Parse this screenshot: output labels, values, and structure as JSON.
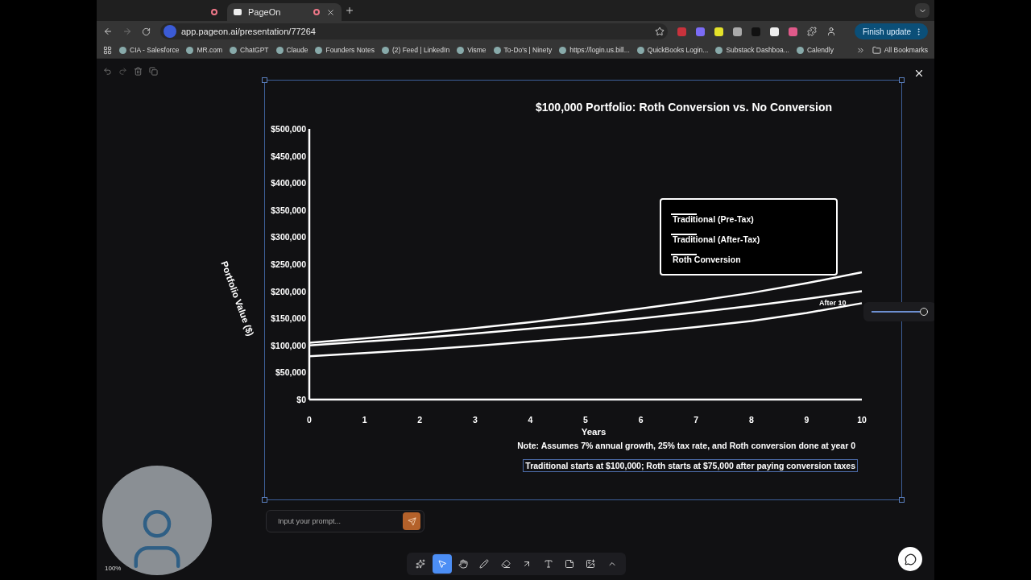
{
  "browser": {
    "tabs": [
      {
        "selected": false
      },
      {
        "label": "PageOn",
        "selected": true
      }
    ],
    "url": "app.pageon.ai/presentation/77264",
    "update_button": "Finish update",
    "bookmarks": [
      {
        "label": "CIA - Salesforce"
      },
      {
        "label": "MR.com"
      },
      {
        "label": "ChatGPT"
      },
      {
        "label": "Claude"
      },
      {
        "label": "Founders Notes"
      },
      {
        "label": "(2) Feed | LinkedIn"
      },
      {
        "label": "Visme"
      },
      {
        "label": "To-Do's | Ninety"
      },
      {
        "label": "https://login.us.bill..."
      },
      {
        "label": "QuickBooks Login..."
      },
      {
        "label": "Substack Dashboa..."
      },
      {
        "label": "Calendly"
      }
    ],
    "all_bookmarks": "All Bookmarks"
  },
  "slide": {
    "chart_data": {
      "type": "line",
      "title": "$100,000 Portfolio: Roth Conversion vs. No Conversion",
      "xlabel": "Years",
      "ylabel": "Portfolio Value ($)",
      "x": [
        0,
        1,
        2,
        3,
        4,
        5,
        6,
        7,
        8,
        9,
        10
      ],
      "xlim": [
        0,
        10
      ],
      "ylim": [
        0,
        500000
      ],
      "xticks": [
        0,
        1,
        2,
        3,
        4,
        5,
        6,
        7,
        8,
        9,
        10
      ],
      "yticks": [
        {
          "value": 0,
          "label": "$0"
        },
        {
          "value": 50000,
          "label": "$50,000"
        },
        {
          "value": 100000,
          "label": "$100,000"
        },
        {
          "value": 150000,
          "label": "$150,000"
        },
        {
          "value": 200000,
          "label": "$200,000"
        },
        {
          "value": 250000,
          "label": "$250,000"
        },
        {
          "value": 300000,
          "label": "$300,000"
        },
        {
          "value": 350000,
          "label": "$350,000"
        },
        {
          "value": 400000,
          "label": "$400,000"
        },
        {
          "value": 450000,
          "label": "$450,000"
        },
        {
          "value": 500000,
          "label": "$500,000"
        }
      ],
      "series": [
        {
          "name": "Traditional (Pre-Tax)",
          "color": "#ffffff",
          "values": [
            105000,
            113000,
            122000,
            132000,
            143000,
            155000,
            168000,
            182000,
            197000,
            215000,
            235000
          ]
        },
        {
          "name": "Traditional (After-Tax)",
          "color": "#ffffff",
          "values": [
            100000,
            107000,
            114000,
            122000,
            131000,
            140000,
            150000,
            161000,
            173000,
            186000,
            200000
          ]
        },
        {
          "name": "Roth Conversion",
          "color": "#ffffff",
          "values": [
            80000,
            86000,
            92000,
            99000,
            107000,
            115000,
            124000,
            134000,
            145000,
            160000,
            178000
          ]
        }
      ],
      "legend": true,
      "annotations": [
        "After 10"
      ]
    },
    "notes": [
      "Note: Assumes 7% annual growth, 25% tax rate, and Roth conversion done at year 0",
      "Traditional starts at $100,000; Roth starts at $75,000 after paying conversion taxes"
    ]
  },
  "slider": {
    "level": 1
  },
  "prompt": {
    "placeholder": "Input your prompt..."
  },
  "tools": [
    {
      "kind": "magic",
      "selected": false
    },
    {
      "kind": "select",
      "selected": true
    },
    {
      "kind": "hand",
      "selected": false
    },
    {
      "kind": "draw",
      "selected": false
    },
    {
      "kind": "eraser",
      "selected": false
    },
    {
      "kind": "arrow",
      "selected": false
    },
    {
      "kind": "text",
      "selected": false
    },
    {
      "kind": "note",
      "selected": false
    },
    {
      "kind": "media",
      "selected": false
    },
    {
      "kind": "more",
      "selected": false
    }
  ],
  "zoom": "100%"
}
